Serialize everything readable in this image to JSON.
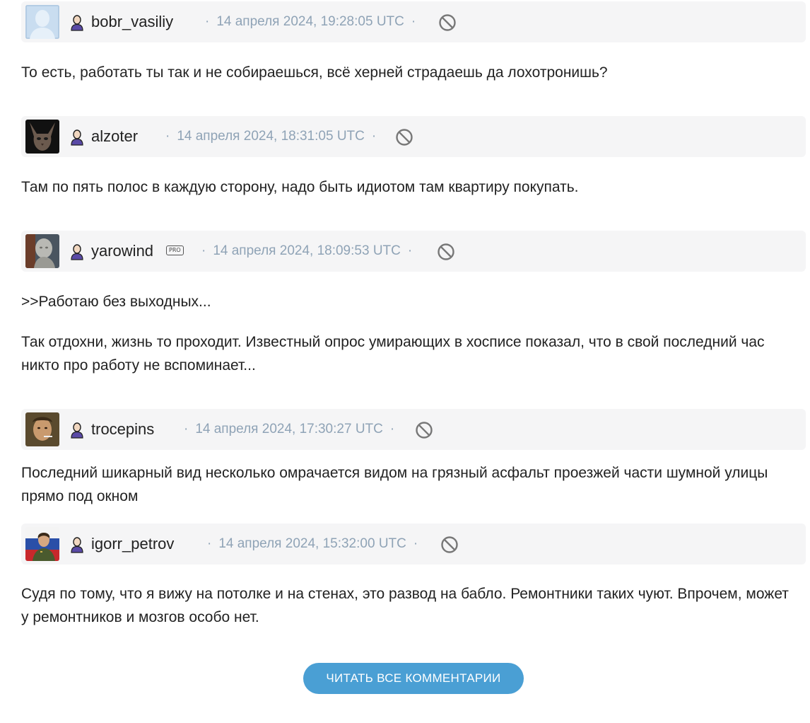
{
  "comments": [
    {
      "username": "bobr_vasiliy",
      "pro": false,
      "timestamp": "14 апреля 2024, 19:28:05 UTC",
      "avatar": "default-avatar",
      "body": [
        "То есть, работать ты так и не собираешься, всё херней страдаешь да лохотронишь?"
      ]
    },
    {
      "username": "alzoter",
      "pro": false,
      "timestamp": "14 апреля 2024, 18:31:05 UTC",
      "avatar": "sphynx-cat-avatar",
      "body": [
        "Там по пять полос в каждую сторону, надо быть идиотом там квартиру покупать."
      ]
    },
    {
      "username": "yarowind",
      "pro": true,
      "pro_label": "PRO",
      "timestamp": "14 апреля 2024, 18:09:53 UTC",
      "avatar": "statue-avatar",
      "body": [
        ">>Работаю без выходных...",
        "Так отдохни, жизнь то проходит. Известный опрос умирающих в хосписе показал, что в свой последний час никто про работу не вспоминает..."
      ]
    },
    {
      "username": "trocepins",
      "pro": false,
      "timestamp": "14 апреля 2024, 17:30:27 UTC",
      "avatar": "man-smoking-avatar",
      "body": [
        "Последний шикарный вид несколько омрачается видом на грязный асфальт проезжей части шумной улицы прямо под окном"
      ]
    },
    {
      "username": "igorr_petrov",
      "pro": false,
      "timestamp": "14 апреля 2024, 15:32:00 UTC",
      "avatar": "officer-flag-avatar",
      "body": [
        "Судя по тому, что я вижу на потолке и на стенах, это развод на бабло. Ремонтники таких чуют. Впрочем, может у ремонтников и мозгов особо нет."
      ]
    }
  ],
  "icons": {
    "user": "user-icon",
    "block": "block-icon",
    "separator": "·"
  },
  "read_all_button": "ЧИТАТЬ ВСЕ КОММЕНТАРИИ",
  "colors": {
    "header_bg": "#f5f5f6",
    "meta": "#8fa3b6",
    "button": "#4a9fd4",
    "text": "#222222"
  }
}
